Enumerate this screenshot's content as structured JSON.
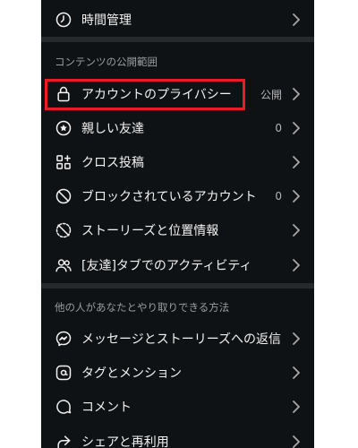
{
  "top_item": {
    "label": "時間管理",
    "icon": "clock-icon"
  },
  "section_visibility": {
    "title": "コンテンツの公開範囲",
    "items": [
      {
        "label": "アカウントのプライバシー",
        "value": "公開",
        "icon": "lock-icon"
      },
      {
        "label": "親しい友達",
        "value": "0",
        "icon": "star-circle-icon"
      },
      {
        "label": "クロス投稿",
        "value": "",
        "icon": "grid-plus-icon"
      },
      {
        "label": "ブロックされているアカウント",
        "value": "0",
        "icon": "block-icon"
      },
      {
        "label": "ストーリーズと位置情報",
        "value": "",
        "icon": "story-off-icon"
      },
      {
        "label": "[友達]タブでのアクティビティ",
        "value": "",
        "icon": "people-icon"
      }
    ]
  },
  "section_interaction": {
    "title": "他の人があなたとやり取りできる方法",
    "items": [
      {
        "label": "メッセージとストーリーズへの返信",
        "icon": "messenger-icon"
      },
      {
        "label": "タグとメンション",
        "icon": "at-icon"
      },
      {
        "label": "コメント",
        "icon": "comment-icon"
      },
      {
        "label": "シェアと再利用",
        "icon": "share-icon"
      }
    ]
  },
  "colors": {
    "background": "#0f1214",
    "highlight": "#ea1c24",
    "divider": "#26292c"
  }
}
